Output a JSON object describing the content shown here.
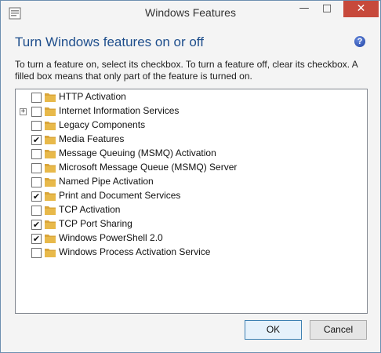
{
  "window": {
    "title": "Windows Features",
    "controls": {
      "minimize": "—",
      "maximize": "□",
      "close": "✕"
    }
  },
  "heading": "Turn Windows features on or off",
  "help_icon": "?",
  "description": "To turn a feature on, select its checkbox. To turn a feature off, clear its checkbox. A filled box means that only part of the feature is turned on.",
  "features": [
    {
      "label": "HTTP Activation",
      "checked": false,
      "expandable": false
    },
    {
      "label": "Internet Information Services",
      "checked": false,
      "expandable": true
    },
    {
      "label": "Legacy Components",
      "checked": false,
      "expandable": false
    },
    {
      "label": "Media Features",
      "checked": true,
      "expandable": false
    },
    {
      "label": "Message Queuing (MSMQ) Activation",
      "checked": false,
      "expandable": false
    },
    {
      "label": "Microsoft Message Queue (MSMQ) Server",
      "checked": false,
      "expandable": false
    },
    {
      "label": "Named Pipe Activation",
      "checked": false,
      "expandable": false
    },
    {
      "label": "Print and Document Services",
      "checked": true,
      "expandable": false
    },
    {
      "label": "TCP Activation",
      "checked": false,
      "expandable": false
    },
    {
      "label": "TCP Port Sharing",
      "checked": true,
      "expandable": false
    },
    {
      "label": "Windows PowerShell 2.0",
      "checked": true,
      "expandable": false
    },
    {
      "label": "Windows Process Activation Service",
      "checked": false,
      "expandable": false
    }
  ],
  "buttons": {
    "ok": "OK",
    "cancel": "Cancel"
  },
  "colors": {
    "heading": "#1e4e8c",
    "close_button": "#c7493b",
    "folder": "#e8b94a"
  }
}
